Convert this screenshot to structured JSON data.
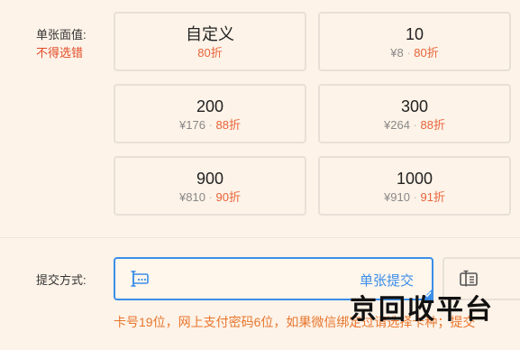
{
  "face_value": {
    "label": "单张面值:",
    "note": "不得选错"
  },
  "cards": [
    {
      "title": "自定义",
      "price": "",
      "discount": "80折"
    },
    {
      "title": "10",
      "price": "¥8",
      "discount": "80折"
    },
    {
      "title": "200",
      "price": "¥176",
      "discount": "88折"
    },
    {
      "title": "300",
      "price": "¥264",
      "discount": "88折"
    },
    {
      "title": "900",
      "price": "¥810",
      "discount": "90折"
    },
    {
      "title": "1000",
      "price": "¥910",
      "discount": "91折"
    }
  ],
  "separator": "·",
  "submit": {
    "label": "提交方式:",
    "method_single": "单张提交",
    "hint": "卡号19位，网上支付密码6位，如果微信绑定过请选择卡种；提交"
  },
  "watermark": "京回收平台",
  "colors": {
    "accent": "#3b8ee8",
    "discount": "#e8643a",
    "warning": "#e24b26",
    "hint": "#e8762e"
  }
}
